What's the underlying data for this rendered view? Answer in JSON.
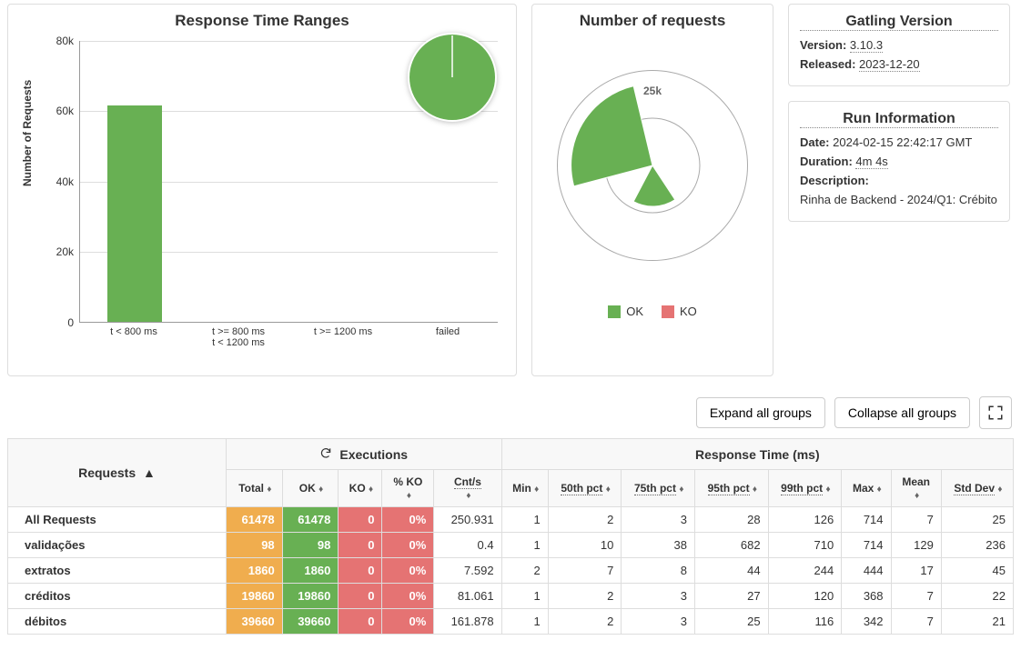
{
  "colors": {
    "ok": "#68b053",
    "ko": "#e57373",
    "total": "#f0ad4e",
    "border": "#ddd"
  },
  "rt_chart": {
    "title": "Response Time Ranges",
    "ylabel": "Number of Requests",
    "yticks": [
      "0",
      "20k",
      "40k",
      "60k",
      "80k"
    ],
    "categories": [
      "t < 800 ms",
      "t >= 800 ms\nt < 1200 ms",
      "t >= 1200 ms",
      "failed"
    ]
  },
  "pie": {
    "ok_pct": 100,
    "ko_pct": 0
  },
  "req_panel": {
    "title": "Number of requests",
    "polar_tick": "25k",
    "legend_ok": "OK",
    "legend_ko": "KO"
  },
  "version_panel": {
    "title": "Gatling Version",
    "version_label": "Version:",
    "version": "3.10.3",
    "released_label": "Released:",
    "released": "2023-12-20"
  },
  "run_panel": {
    "title": "Run Information",
    "date_label": "Date:",
    "date": "2024-02-15 22:42:17 GMT",
    "duration_label": "Duration:",
    "duration": "4m 4s",
    "desc_label": "Description:",
    "desc": "Rinha de Backend - 2024/Q1: Crébito"
  },
  "controls": {
    "expand": "Expand all groups",
    "collapse": "Collapse all groups"
  },
  "table": {
    "col_requests": "Requests",
    "group_exec": "Executions",
    "group_rt": "Response Time (ms)",
    "cols_exec": [
      "Total",
      "OK",
      "KO",
      "% KO",
      "Cnt/s"
    ],
    "cols_rt": [
      "Min",
      "50th pct",
      "75th pct",
      "95th pct",
      "99th pct",
      "Max",
      "Mean",
      "Std Dev"
    ],
    "rows": [
      {
        "name": "All Requests",
        "total": "61478",
        "ok": "61478",
        "ko": "0",
        "kopct": "0%",
        "cnts": "250.931",
        "min": "1",
        "p50": "2",
        "p75": "3",
        "p95": "28",
        "p99": "126",
        "max": "714",
        "mean": "7",
        "sd": "25"
      },
      {
        "name": "validações",
        "total": "98",
        "ok": "98",
        "ko": "0",
        "kopct": "0%",
        "cnts": "0.4",
        "min": "1",
        "p50": "10",
        "p75": "38",
        "p95": "682",
        "p99": "710",
        "max": "714",
        "mean": "129",
        "sd": "236"
      },
      {
        "name": "extratos",
        "total": "1860",
        "ok": "1860",
        "ko": "0",
        "kopct": "0%",
        "cnts": "7.592",
        "min": "2",
        "p50": "7",
        "p75": "8",
        "p95": "44",
        "p99": "244",
        "max": "444",
        "mean": "17",
        "sd": "45"
      },
      {
        "name": "créditos",
        "total": "19860",
        "ok": "19860",
        "ko": "0",
        "kopct": "0%",
        "cnts": "81.061",
        "min": "1",
        "p50": "2",
        "p75": "3",
        "p95": "27",
        "p99": "120",
        "max": "368",
        "mean": "7",
        "sd": "22"
      },
      {
        "name": "débitos",
        "total": "39660",
        "ok": "39660",
        "ko": "0",
        "kopct": "0%",
        "cnts": "161.878",
        "min": "1",
        "p50": "2",
        "p75": "3",
        "p95": "25",
        "p99": "116",
        "max": "342",
        "mean": "7",
        "sd": "21"
      }
    ]
  },
  "chart_data": [
    {
      "type": "bar",
      "title": "Response Time Ranges",
      "ylabel": "Number of Requests",
      "categories": [
        "t < 800 ms",
        "t >= 800 ms t < 1200 ms",
        "t >= 1200 ms",
        "failed"
      ],
      "values": [
        61478,
        0,
        0,
        0
      ],
      "ylim": [
        0,
        80000
      ]
    },
    {
      "type": "pie",
      "title": "Response Time Ranges (pie inset)",
      "series": [
        {
          "name": "t < 800 ms",
          "value": 61478
        },
        {
          "name": "t >= 800 ms t < 1200 ms",
          "value": 0
        },
        {
          "name": "t >= 1200 ms",
          "value": 0
        },
        {
          "name": "failed",
          "value": 0
        }
      ]
    },
    {
      "type": "pie",
      "title": "Number of requests (OK/KO per request)",
      "categories": [
        "validações",
        "extratos",
        "créditos",
        "débitos"
      ],
      "series": [
        {
          "name": "OK",
          "values": [
            98,
            1860,
            19860,
            39660
          ]
        },
        {
          "name": "KO",
          "values": [
            0,
            0,
            0,
            0
          ]
        }
      ],
      "polar_max": 50000
    }
  ]
}
